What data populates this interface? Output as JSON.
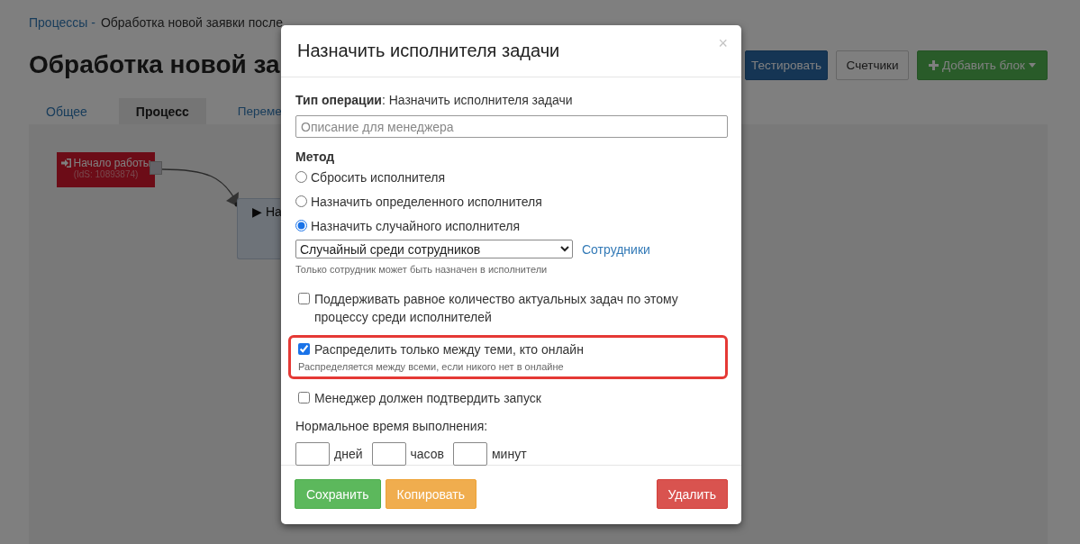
{
  "breadcrumb": {
    "parent": "Процессы -",
    "current": "Обработка новой заявки после"
  },
  "page_title": "Обработка новой за",
  "toolbar": [
    {
      "label": "Тестировать",
      "kind": "primary"
    },
    {
      "label": "Счетчики",
      "kind": "default"
    },
    {
      "label": "Добавить блок",
      "kind": "add"
    }
  ],
  "tabs": [
    {
      "label": "Общее",
      "selected": false
    },
    {
      "label": "Процесс",
      "selected": true
    },
    {
      "label": "Переме",
      "selected": false
    }
  ],
  "canvas": {
    "nodes": [
      {
        "kind": "start",
        "title": "Начало работы",
        "subtitle": "(IdS: 10893874)"
      },
      {
        "kind": "step",
        "title": "▶ На"
      }
    ]
  },
  "modal": {
    "title": "Назначить исполнителя задачи",
    "close": "×",
    "operation": "**Тип операции**: Назначить исполнителя задачи",
    "description": {
      "placeholder": "Описание для менеджера"
    },
    "method_label": "Метод",
    "methods": [
      {
        "label": "Сбросить исполнителя",
        "selected": false
      },
      {
        "label": "Назначить определенного исполнителя",
        "selected": false
      },
      {
        "label": "Назначить случайного исполнителя",
        "selected": true
      }
    ],
    "select": {
      "value": "Случайный среди сотрудников"
    },
    "select_link": "Сотрудники",
    "select_hint": "Только сотрудник может быть назначен в исполнители",
    "options": [
      {
        "label": "Поддерживать равное количество актуальных задач по этому процессу среди исполнителей",
        "checked": false,
        "highlighted": false
      },
      {
        "label": "Распределить только между теми, кто онлайн",
        "hint": "Распределяется между всеми, если никого нет в онлайне",
        "checked": true,
        "highlighted": true
      },
      {
        "label": "Менеджер должен подтвердить запуск",
        "checked": false,
        "highlighted": false
      }
    ],
    "duration_label": "Нормальное время выполнения:",
    "duration_fields": [
      {
        "unit": "дней"
      },
      {
        "unit": "часов"
      },
      {
        "unit": "минут"
      }
    ],
    "footer_buttons": [
      {
        "label": "Сохранить",
        "kind": "success"
      },
      {
        "label": "Копировать",
        "kind": "warning"
      },
      {
        "label": "Удалить",
        "kind": "danger"
      }
    ]
  }
}
